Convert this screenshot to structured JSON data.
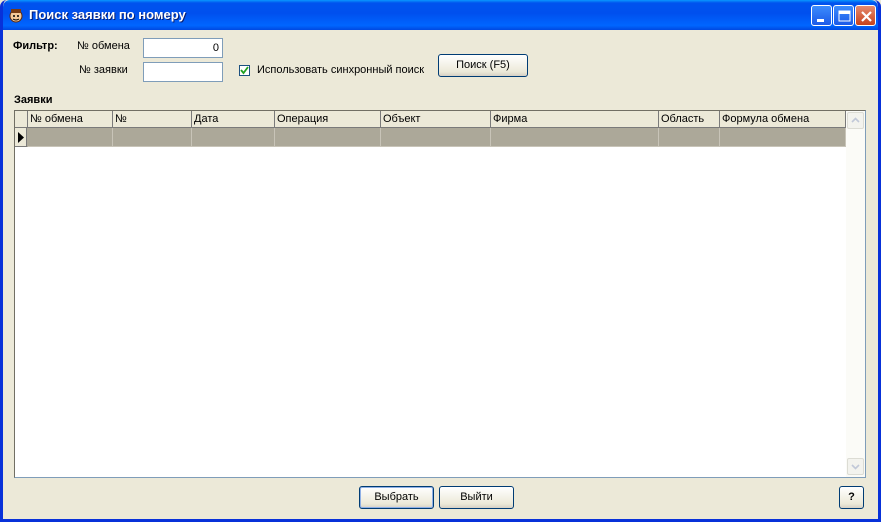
{
  "window": {
    "title": "Поиск заявки по номеру",
    "icon": "app-icon"
  },
  "filter": {
    "label": "Фильтр:",
    "exchange_label": "№ обмена",
    "exchange_value": "0",
    "request_label": "№ заявки",
    "request_value": "",
    "sync_label": "Использовать синхронный поиск",
    "sync_checked": true,
    "search_button": "Поиск (F5)"
  },
  "requests": {
    "label": "Заявки",
    "columns": [
      "№ обмена",
      "№",
      "Дата",
      "Операция",
      "Объект",
      "Фирма",
      "Область",
      "Формула обмена"
    ],
    "rows": [
      [
        "",
        "",
        "",
        "",
        "",
        "",
        "",
        ""
      ]
    ]
  },
  "footer": {
    "select_button": "Выбрать",
    "exit_button": "Выйти",
    "help_button": "?"
  }
}
